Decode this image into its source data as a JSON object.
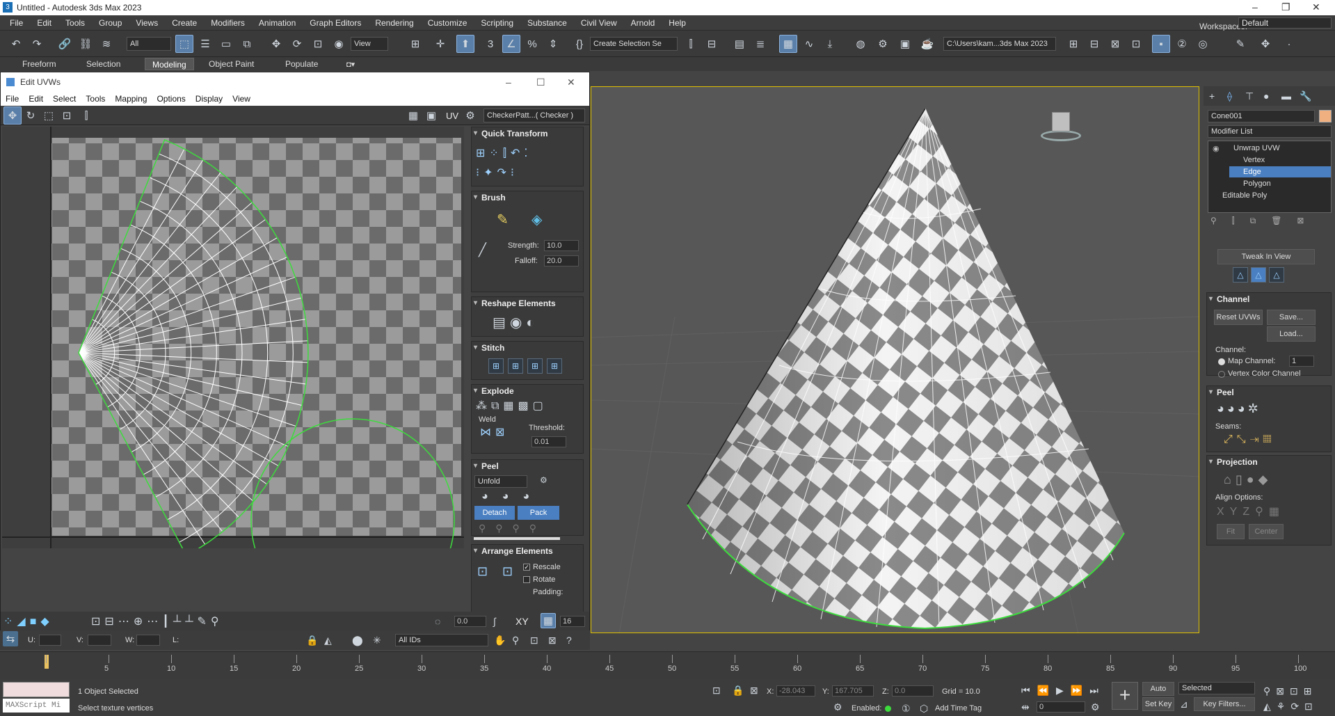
{
  "app": {
    "title": "Untitled - Autodesk 3ds Max 2023",
    "workspace_label": "Workspaces:",
    "workspace": "Default"
  },
  "menu": [
    "File",
    "Edit",
    "Tools",
    "Group",
    "Views",
    "Create",
    "Modifiers",
    "Animation",
    "Graph Editors",
    "Rendering",
    "Customize",
    "Scripting",
    "Substance",
    "Civil View",
    "Arnold",
    "Help"
  ],
  "toolbar": {
    "filter": "All",
    "ref_coord": "View",
    "selection_set": "Create Selection Se",
    "project_path": "C:\\Users\\kam...3ds Max 2023"
  },
  "ribbon": {
    "tabs": [
      "Freeform",
      "Selection",
      "Modeling",
      "Object Paint",
      "Populate"
    ],
    "active": "Modeling"
  },
  "uvw": {
    "title": "Edit UVWs",
    "menu": [
      "File",
      "Edit",
      "Select",
      "Tools",
      "Mapping",
      "Options",
      "Display",
      "View"
    ],
    "uv_label": "UV",
    "texture": "CheckerPatt...( Checker )",
    "panel": {
      "quick_transform": "Quick Transform",
      "brush": "Brush",
      "strength_label": "Strength:",
      "strength": "10.0",
      "falloff_label": "Falloff:",
      "falloff": "20.0",
      "reshape": "Reshape Elements",
      "stitch": "Stitch",
      "explode": "Explode",
      "weld": "Weld",
      "threshold_label": "Threshold:",
      "threshold": "0.01",
      "peel": "Peel",
      "unfold": "Unfold",
      "detach": "Detach",
      "pack": "Pack",
      "arrange": "Arrange Elements",
      "rescale": "Rescale",
      "rotate": "Rotate",
      "padding": "Padding:"
    },
    "bottom": {
      "spin1": "0.0",
      "xy": "XY",
      "spin2": "16",
      "u": "U:",
      "v": "V:",
      "w": "W:",
      "l": "L:",
      "ids": "All IDs"
    }
  },
  "command_panel": {
    "object_name": "Cone001",
    "color": "#f0b080",
    "modifier_list": "Modifier List",
    "stack": [
      "Unwrap UVW",
      "Vertex",
      "Edge",
      "Polygon",
      "Editable Poly"
    ],
    "selected": "Edge",
    "tweak": "Tweak In View",
    "channel": "Channel",
    "reset_uvws": "Reset UVWs",
    "save": "Save...",
    "load": "Load...",
    "channel_label": "Channel:",
    "map_channel": "Map Channel:",
    "map_channel_value": "1",
    "vertex_color_channel": "Vertex Color Channel",
    "peel": "Peel",
    "seams": "Seams:",
    "projection": "Projection",
    "align_options": "Align Options:",
    "fit": "Fit",
    "center": "Center"
  },
  "timeline": {
    "ticks": [
      "0",
      "5",
      "10",
      "15",
      "20",
      "25",
      "30",
      "35",
      "40",
      "45",
      "50",
      "55",
      "60",
      "65",
      "70",
      "75",
      "80",
      "85",
      "90",
      "95",
      "100"
    ]
  },
  "status": {
    "maxscript": "MAXScript Mi",
    "selected": "1 Object Selected",
    "prompt": "Select texture vertices",
    "x_label": "X:",
    "x": "-28.043",
    "y_label": "Y:",
    "y": "167.705",
    "z_label": "Z:",
    "z": "0.0",
    "grid": "Grid = 10.0",
    "enabled": "Enabled:",
    "add_time_tag": "Add Time Tag",
    "auto_key": "Auto Key",
    "set_key": "Set Key",
    "selected_dd": "Selected",
    "key_filters": "Key Filters...",
    "frame": "0"
  }
}
